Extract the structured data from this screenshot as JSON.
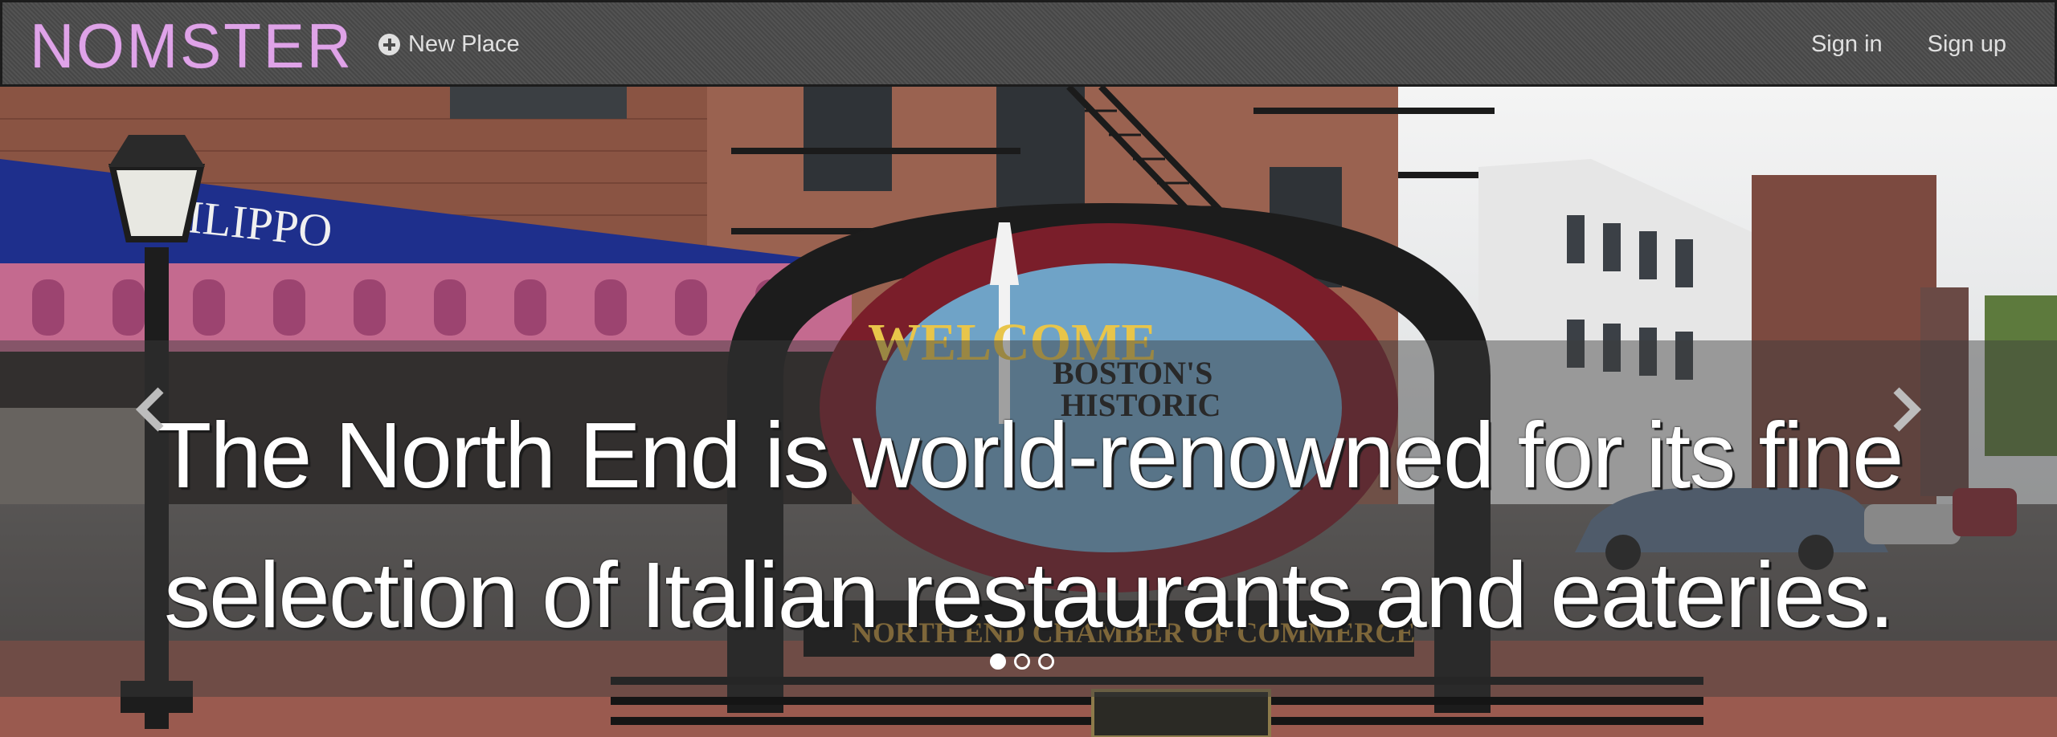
{
  "nav": {
    "brand": "NOMSTER",
    "new_place": "New Place",
    "sign_in": "Sign in",
    "sign_up": "Sign up"
  },
  "carousel": {
    "caption": "The North End is world-renowned for its fine selection of Italian restaurants and eateries.",
    "slide_count": 3,
    "active_slide": 1
  },
  "photo_text": {
    "awning": "FILIPPO",
    "sign_ring": "WELCOME",
    "sign_line1": "BOSTON'S",
    "sign_line2": "HISTORIC",
    "sign_bottom": "NORTH END CHAMBER OF COMMERCE"
  },
  "colors": {
    "brand": "#dfa3e8",
    "navbar": "#4b4b4b",
    "nav_text": "#e0e0e0"
  },
  "icons": {
    "new_place": "plus-circle-icon",
    "prev": "chevron-left-icon",
    "next": "chevron-right-icon"
  }
}
